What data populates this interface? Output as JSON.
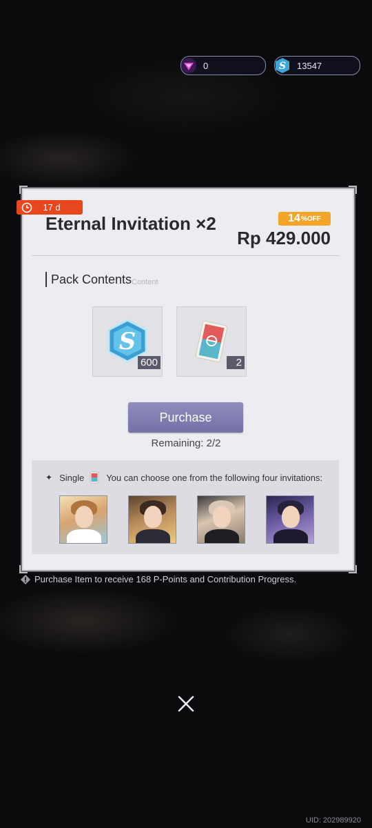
{
  "currency": {
    "gems": "0",
    "stellarite": "13547",
    "gems_icon": "purple-triangle-gem-icon",
    "stellarite_icon": "blue-s-coin-icon"
  },
  "offer": {
    "timer": "17 d",
    "title": "Eternal Invitation ×2",
    "discount_value": "14",
    "discount_suffix": "%OFF",
    "price": "Rp 429.000"
  },
  "pack": {
    "label": "Pack Contents",
    "sublabel": "Content",
    "items": [
      {
        "icon": "stellarite-crystal-icon",
        "qty": "600"
      },
      {
        "icon": "invitation-card-icon",
        "qty": "2"
      }
    ]
  },
  "purchase": {
    "button_label": "Purchase",
    "remaining": "Remaining: 2/2"
  },
  "choose": {
    "prefix": "Single",
    "text": "You can choose one from the following four invitations:"
  },
  "notice": "Purchase Item to receive 168 P-Points and Contribution Progress.",
  "uid": "UID: 202989920",
  "colors": {
    "accent": "#7f7db0",
    "timer": "#e8471d",
    "discount": "#f3a52a"
  }
}
